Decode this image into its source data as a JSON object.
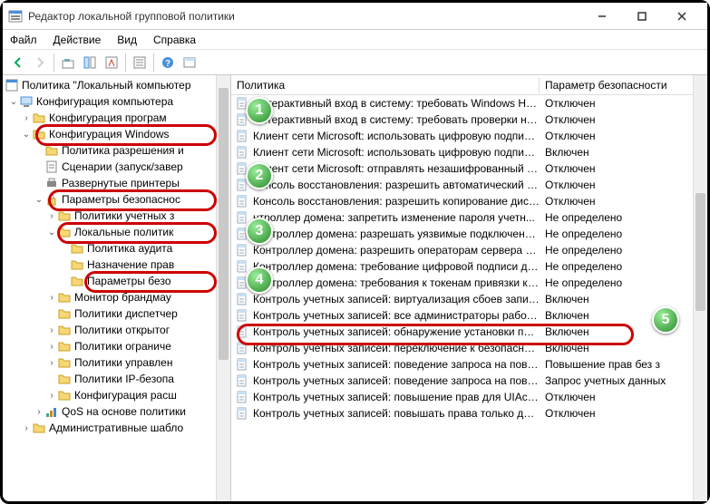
{
  "window": {
    "title": "Редактор локальной групповой политики"
  },
  "menu": {
    "file": "Файл",
    "action": "Действие",
    "view": "Вид",
    "help": "Справка"
  },
  "tree": {
    "root": "Политика \"Локальный компьютер",
    "n0": "Конфигурация компьютера",
    "n1": "Конфигурация програм",
    "n2": "Конфигурация Windows",
    "n3": "Политика разрешения и",
    "n4": "Сценарии (запуск/завер",
    "n5": "Развернутые принтеры",
    "n6": "Параметры безопаснос",
    "n7": "Политики учетных з",
    "n8": "Локальные политик",
    "n9": "Политика аудита",
    "n10": "Назначение прав",
    "n11": "Параметры безо",
    "n12": "Монитор брандмау",
    "n13": "Политики диспетчер",
    "n14": "Политики открытог",
    "n15": "Политики ограниче",
    "n16": "Политики управлен",
    "n17": "Политики IP-безопа",
    "n18": "Конфигурация расш",
    "n19": "QoS на основе политики",
    "n20": "Административные шабло"
  },
  "list": {
    "header_policy": "Политика",
    "header_param": "Параметр безопасности",
    "rows": [
      {
        "p": "Интерактивный вход в систему: требовать Windows Hello...",
        "s": "Отключен"
      },
      {
        "p": "Интерактивный вход в систему: требовать проверки на к...",
        "s": "Отключен"
      },
      {
        "p": "Клиент сети Microsoft: использовать цифровую подпись ...",
        "s": "Отключен"
      },
      {
        "p": "Клиент сети Microsoft: использовать цифровую подпись ...",
        "s": "Включен"
      },
      {
        "p": "Клиент сети Microsoft: отправлять незашифрованный па...",
        "s": "Отключен"
      },
      {
        "p": "Консоль восстановления: разрешить автоматический вх...",
        "s": "Отключен"
      },
      {
        "p": "Консоль восстановления: разрешить копирование диске...",
        "s": "Отключен"
      },
      {
        "p": "нтроллер домена: запретить изменение пароля учетн...",
        "s": "Не определено"
      },
      {
        "p": "Контроллер домена: разрешать уязвимые подключения ...",
        "s": "Не определено"
      },
      {
        "p": "Контроллер домена: разрешить операторам сервера зад...",
        "s": "Не определено"
      },
      {
        "p": "Контроллер домена: требование цифровой подписи для ...",
        "s": "Не определено"
      },
      {
        "p": "Контроллер домена: требования к токенам привязки кан...",
        "s": "Не определено"
      },
      {
        "p": "Контроль учетных записей: виртуализация сбоев записи ...",
        "s": "Включен"
      },
      {
        "p": "Контроль учетных записей: все администраторы работа...",
        "s": "Включен"
      },
      {
        "p": "Контроль учетных записей: обнаружение установки при...",
        "s": "Включен"
      },
      {
        "p": "Контроль учетных записей: переключение к безопасном...",
        "s": "Включен"
      },
      {
        "p": "Контроль учетных записей: поведение запроса на повы...",
        "s": "Повышение прав без з"
      },
      {
        "p": "Контроль учетных записей: поведение запроса на повы...",
        "s": "Запрос учетных данных"
      },
      {
        "p": "Контроль учетных записей: повышение прав для UIAcces...",
        "s": "Отключен"
      },
      {
        "p": "Контроль учетных записей: повышать права только для ...",
        "s": "Отключен"
      }
    ]
  },
  "markers": {
    "m1": "1",
    "m2": "2",
    "m3": "3",
    "m4": "4",
    "m5": "5"
  }
}
